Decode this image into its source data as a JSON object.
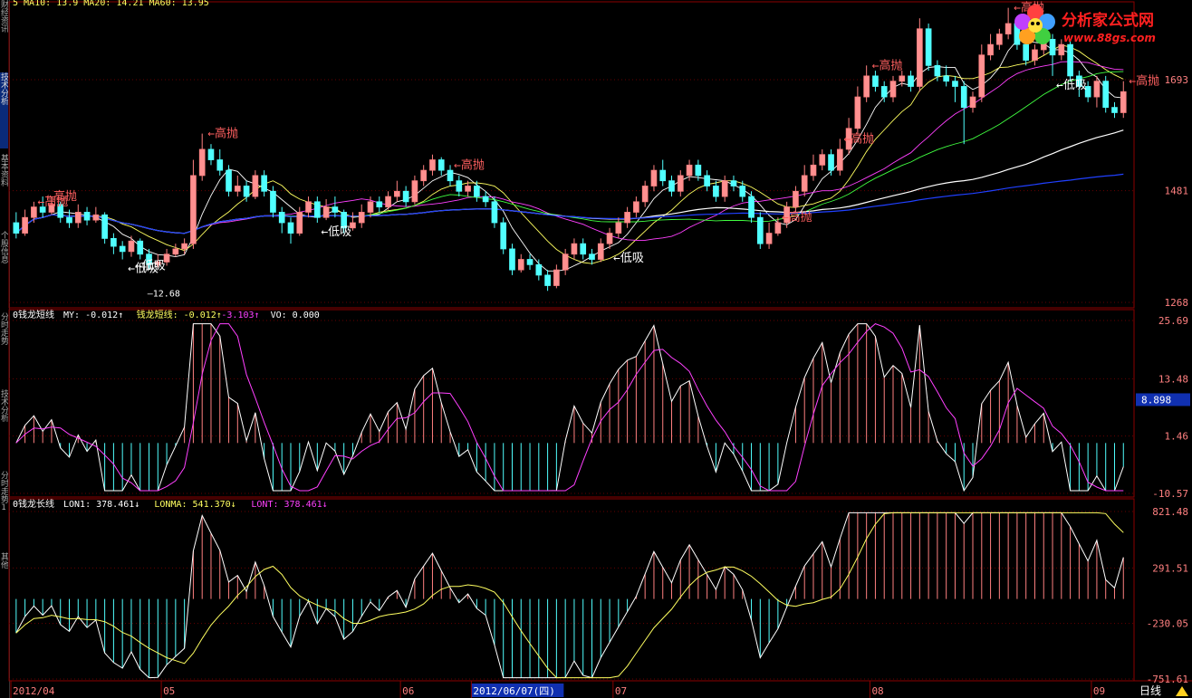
{
  "side_tabs": [
    "财经资讯",
    "技术分析",
    "基本资料",
    "个股信息",
    "分时走势",
    "技术分析",
    "分时走势1",
    "其他"
  ],
  "header_tops": [
    "5  MA10: 13.9  MA20: 14.21  MA60: 13.95"
  ],
  "logo": {
    "title": "分析家公式网",
    "url": "www.88gs.com"
  },
  "colors": {
    "up": "#ff8080",
    "down": "#50ffff",
    "border": "#8b0000",
    "ma5": "#ffffff",
    "ma10": "#ffff60",
    "ma20": "#ff40ff",
    "ma30": "#40ff40",
    "ma60": "#ffffff",
    "ma120": "#2040ff"
  },
  "panels": {
    "price": {
      "right_ticks": [
        "1693",
        "1481",
        "1268"
      ],
      "annotations": [
        {
          "text": "高抛",
          "pos": "left"
        },
        {
          "text": "高抛",
          "pos": "left"
        },
        {
          "text": "高抛",
          "pos": "right"
        },
        {
          "text": "低吸",
          "pos": "left"
        },
        {
          "text": "高抛",
          "pos": "left"
        },
        {
          "text": "低吸",
          "pos": "left"
        },
        {
          "text": "高抛",
          "pos": "left"
        },
        {
          "text": "高抛",
          "pos": "left"
        },
        {
          "text": "高抛",
          "pos": "right"
        },
        {
          "text": "高抛",
          "pos": "right"
        },
        {
          "text": "低吸",
          "pos": "left"
        },
        {
          "text": "高抛",
          "pos": "right"
        },
        {
          "text": "低吸",
          "pos": "right"
        },
        {
          "text": "低吸",
          "pos": "left"
        }
      ],
      "low_label": "12.68"
    },
    "short": {
      "title": "0钱龙短线",
      "items": [
        {
          "label": "MY: -0.012↑",
          "color": "#ffffff"
        },
        {
          "label": "钱龙短线: -0.012↑",
          "color": "#ffff60"
        },
        {
          "label": "-3.103↑",
          "color": "#ff40ff"
        },
        {
          "label": "VO: 0.000",
          "color": "#ffffff"
        }
      ],
      "right_ticks": [
        "25.69",
        "13.48",
        "1.46",
        "-10.57"
      ],
      "current_value": "8.898"
    },
    "long": {
      "title": "0钱龙长线",
      "items": [
        {
          "label": "LON1: 378.461↓",
          "color": "#ffffff"
        },
        {
          "label": "LONMA: 541.370↓",
          "color": "#ffff60"
        },
        {
          "label": "LONT: 378.461↓",
          "color": "#ff40ff"
        }
      ],
      "right_ticks": [
        "821.48",
        "291.51",
        "-230.05",
        "-751.61"
      ]
    }
  },
  "x_axis": {
    "labels": [
      "2012/04",
      "05",
      "06",
      "2012/06/07(四)",
      "07",
      "08",
      "09"
    ],
    "period": "日线"
  },
  "chart_data": {
    "type": "candlestick",
    "ylim": [
      1268,
      1800
    ],
    "candles": [
      [
        1420,
        1400,
        1440,
        1390
      ],
      [
        1400,
        1430,
        1445,
        1395
      ],
      [
        1430,
        1450,
        1460,
        1420
      ],
      [
        1450,
        1440,
        1470,
        1430
      ],
      [
        1440,
        1455,
        1470,
        1435
      ],
      [
        1455,
        1430,
        1460,
        1420
      ],
      [
        1430,
        1420,
        1445,
        1410
      ],
      [
        1420,
        1440,
        1455,
        1410
      ],
      [
        1440,
        1425,
        1450,
        1415
      ],
      [
        1425,
        1435,
        1450,
        1420
      ],
      [
        1435,
        1390,
        1440,
        1380
      ],
      [
        1390,
        1375,
        1400,
        1360
      ],
      [
        1375,
        1365,
        1385,
        1350
      ],
      [
        1365,
        1385,
        1395,
        1355
      ],
      [
        1385,
        1360,
        1390,
        1350
      ],
      [
        1360,
        1340,
        1370,
        1330
      ],
      [
        1340,
        1345,
        1360,
        1335
      ],
      [
        1345,
        1360,
        1370,
        1338
      ],
      [
        1360,
        1370,
        1380,
        1355
      ],
      [
        1370,
        1380,
        1390,
        1360
      ],
      [
        1380,
        1510,
        1540,
        1370
      ],
      [
        1510,
        1560,
        1590,
        1500
      ],
      [
        1560,
        1540,
        1570,
        1530
      ],
      [
        1540,
        1520,
        1560,
        1510
      ],
      [
        1520,
        1480,
        1530,
        1470
      ],
      [
        1480,
        1490,
        1510,
        1470
      ],
      [
        1490,
        1470,
        1500,
        1460
      ],
      [
        1470,
        1510,
        1520,
        1465
      ],
      [
        1510,
        1480,
        1520,
        1470
      ],
      [
        1480,
        1440,
        1490,
        1430
      ],
      [
        1440,
        1420,
        1450,
        1400
      ],
      [
        1420,
        1400,
        1430,
        1380
      ],
      [
        1400,
        1440,
        1450,
        1395
      ],
      [
        1440,
        1460,
        1470,
        1430
      ],
      [
        1460,
        1430,
        1470,
        1420
      ],
      [
        1430,
        1450,
        1465,
        1425
      ],
      [
        1450,
        1440,
        1470,
        1430
      ],
      [
        1440,
        1410,
        1445,
        1400
      ],
      [
        1410,
        1420,
        1440,
        1405
      ],
      [
        1420,
        1440,
        1455,
        1410
      ],
      [
        1440,
        1460,
        1470,
        1430
      ],
      [
        1460,
        1450,
        1470,
        1440
      ],
      [
        1450,
        1470,
        1480,
        1445
      ],
      [
        1470,
        1480,
        1500,
        1460
      ],
      [
        1480,
        1460,
        1490,
        1450
      ],
      [
        1460,
        1500,
        1510,
        1455
      ],
      [
        1500,
        1520,
        1530,
        1490
      ],
      [
        1520,
        1540,
        1550,
        1510
      ],
      [
        1540,
        1520,
        1545,
        1510
      ],
      [
        1520,
        1500,
        1530,
        1490
      ],
      [
        1500,
        1480,
        1510,
        1470
      ],
      [
        1480,
        1490,
        1500,
        1470
      ],
      [
        1490,
        1470,
        1500,
        1460
      ],
      [
        1470,
        1460,
        1480,
        1450
      ],
      [
        1460,
        1420,
        1470,
        1410
      ],
      [
        1420,
        1370,
        1430,
        1360
      ],
      [
        1370,
        1330,
        1380,
        1320
      ],
      [
        1330,
        1350,
        1360,
        1325
      ],
      [
        1350,
        1340,
        1360,
        1330
      ],
      [
        1340,
        1320,
        1350,
        1310
      ],
      [
        1320,
        1300,
        1330,
        1290
      ],
      [
        1300,
        1330,
        1340,
        1295
      ],
      [
        1330,
        1360,
        1370,
        1320
      ],
      [
        1360,
        1380,
        1390,
        1350
      ],
      [
        1380,
        1360,
        1390,
        1350
      ],
      [
        1360,
        1350,
        1370,
        1340
      ],
      [
        1350,
        1380,
        1390,
        1345
      ],
      [
        1380,
        1400,
        1410,
        1370
      ],
      [
        1400,
        1420,
        1430,
        1390
      ],
      [
        1420,
        1440,
        1450,
        1410
      ],
      [
        1440,
        1460,
        1470,
        1430
      ],
      [
        1460,
        1490,
        1500,
        1450
      ],
      [
        1490,
        1520,
        1530,
        1480
      ],
      [
        1520,
        1500,
        1540,
        1490
      ],
      [
        1500,
        1480,
        1510,
        1470
      ],
      [
        1480,
        1510,
        1520,
        1470
      ],
      [
        1510,
        1530,
        1540,
        1500
      ],
      [
        1530,
        1510,
        1540,
        1500
      ],
      [
        1510,
        1490,
        1520,
        1480
      ],
      [
        1490,
        1470,
        1500,
        1460
      ],
      [
        1470,
        1500,
        1510,
        1460
      ],
      [
        1500,
        1490,
        1510,
        1480
      ],
      [
        1490,
        1470,
        1500,
        1460
      ],
      [
        1470,
        1430,
        1480,
        1420
      ],
      [
        1430,
        1380,
        1440,
        1370
      ],
      [
        1380,
        1400,
        1420,
        1370
      ],
      [
        1400,
        1420,
        1430,
        1395
      ],
      [
        1420,
        1450,
        1460,
        1410
      ],
      [
        1450,
        1480,
        1490,
        1440
      ],
      [
        1480,
        1510,
        1530,
        1470
      ],
      [
        1510,
        1530,
        1550,
        1500
      ],
      [
        1530,
        1550,
        1560,
        1520
      ],
      [
        1550,
        1520,
        1560,
        1510
      ],
      [
        1520,
        1560,
        1580,
        1510
      ],
      [
        1560,
        1600,
        1620,
        1550
      ],
      [
        1600,
        1660,
        1680,
        1590
      ],
      [
        1660,
        1700,
        1720,
        1650
      ],
      [
        1700,
        1680,
        1710,
        1670
      ],
      [
        1680,
        1660,
        1690,
        1650
      ],
      [
        1660,
        1690,
        1700,
        1650
      ],
      [
        1690,
        1700,
        1710,
        1680
      ],
      [
        1700,
        1680,
        1710,
        1670
      ],
      [
        1680,
        1790,
        1810,
        1670
      ],
      [
        1790,
        1720,
        1800,
        1710
      ],
      [
        1720,
        1700,
        1730,
        1690
      ],
      [
        1700,
        1690,
        1720,
        1680
      ],
      [
        1690,
        1680,
        1700,
        1650
      ],
      [
        1680,
        1640,
        1690,
        1570
      ],
      [
        1640,
        1660,
        1670,
        1630
      ],
      [
        1660,
        1740,
        1760,
        1650
      ],
      [
        1740,
        1760,
        1780,
        1730
      ],
      [
        1760,
        1780,
        1790,
        1750
      ],
      [
        1780,
        1800,
        1830,
        1770
      ],
      [
        1800,
        1760,
        1810,
        1750
      ],
      [
        1760,
        1730,
        1770,
        1720
      ],
      [
        1730,
        1750,
        1760,
        1720
      ],
      [
        1750,
        1770,
        1780,
        1740
      ],
      [
        1770,
        1740,
        1780,
        1700
      ],
      [
        1740,
        1760,
        1770,
        1730
      ],
      [
        1760,
        1700,
        1770,
        1690
      ],
      [
        1700,
        1680,
        1710,
        1660
      ],
      [
        1680,
        1660,
        1690,
        1650
      ],
      [
        1660,
        1690,
        1700,
        1640
      ],
      [
        1690,
        1640,
        1700,
        1630
      ],
      [
        1640,
        1630,
        1650,
        1620
      ],
      [
        1630,
        1670,
        1690,
        1620
      ]
    ]
  }
}
